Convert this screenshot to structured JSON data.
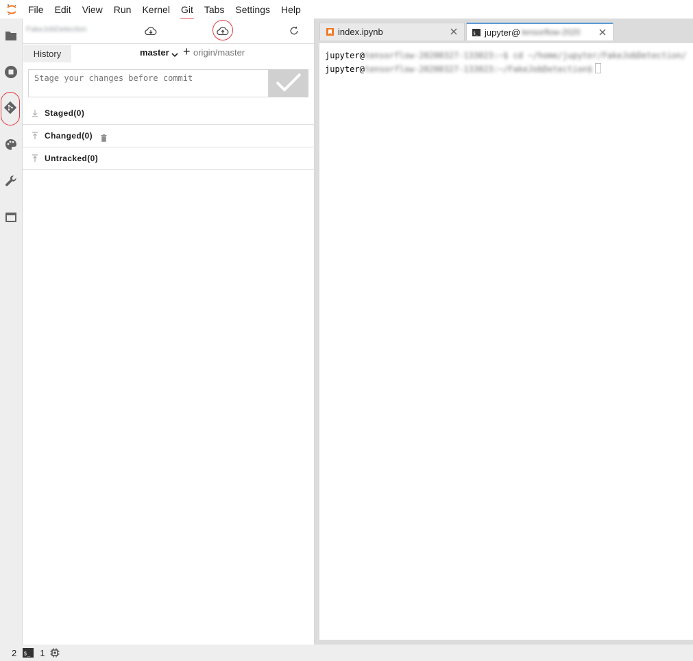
{
  "menubar": {
    "logo": "jupyter-logo-icon",
    "items": [
      "File",
      "Edit",
      "View",
      "Run",
      "Kernel",
      "Git",
      "Tabs",
      "Settings",
      "Help"
    ],
    "active_item": "Git",
    "accent_color": "#e34c4c"
  },
  "activitybar": {
    "icons": [
      "folder-icon",
      "stop-circle-icon",
      "git-icon",
      "palette-icon",
      "wrench-icon",
      "tabs-icon"
    ],
    "selected": "git-icon"
  },
  "git_panel": {
    "repo_name": "FakeJobDetection",
    "toolbar_icons": [
      "cloud-download-icon",
      "cloud-upload-icon",
      "refresh-icon"
    ],
    "history_tab": "History",
    "branch": "master",
    "remote": "origin/master",
    "commit_placeholder": "Stage your changes before commit",
    "sections": {
      "staged": "Staged(0)",
      "changed": "Changed(0)",
      "untracked": "Untracked(0)"
    }
  },
  "tabs": [
    {
      "label": "index.ipynb",
      "icon": "notebook-icon"
    },
    {
      "label": "jupyter@",
      "icon": "terminal-icon",
      "hidden_suffix": "tensorflow-2020"
    }
  ],
  "terminal": {
    "lines": [
      {
        "prompt": "jupyter@",
        "blurred": "tensorflow-20200327-133023:~$ cd ~/home/jupyter/FakeJobDetection/"
      },
      {
        "prompt": "jupyter@",
        "blurred": "tensorflow-20200327-133023:~/FakeJobDetection$"
      }
    ]
  },
  "statusbar": {
    "count_a": "2",
    "count_b": "1",
    "icons": [
      "terminal-small-icon",
      "chip-icon"
    ]
  }
}
